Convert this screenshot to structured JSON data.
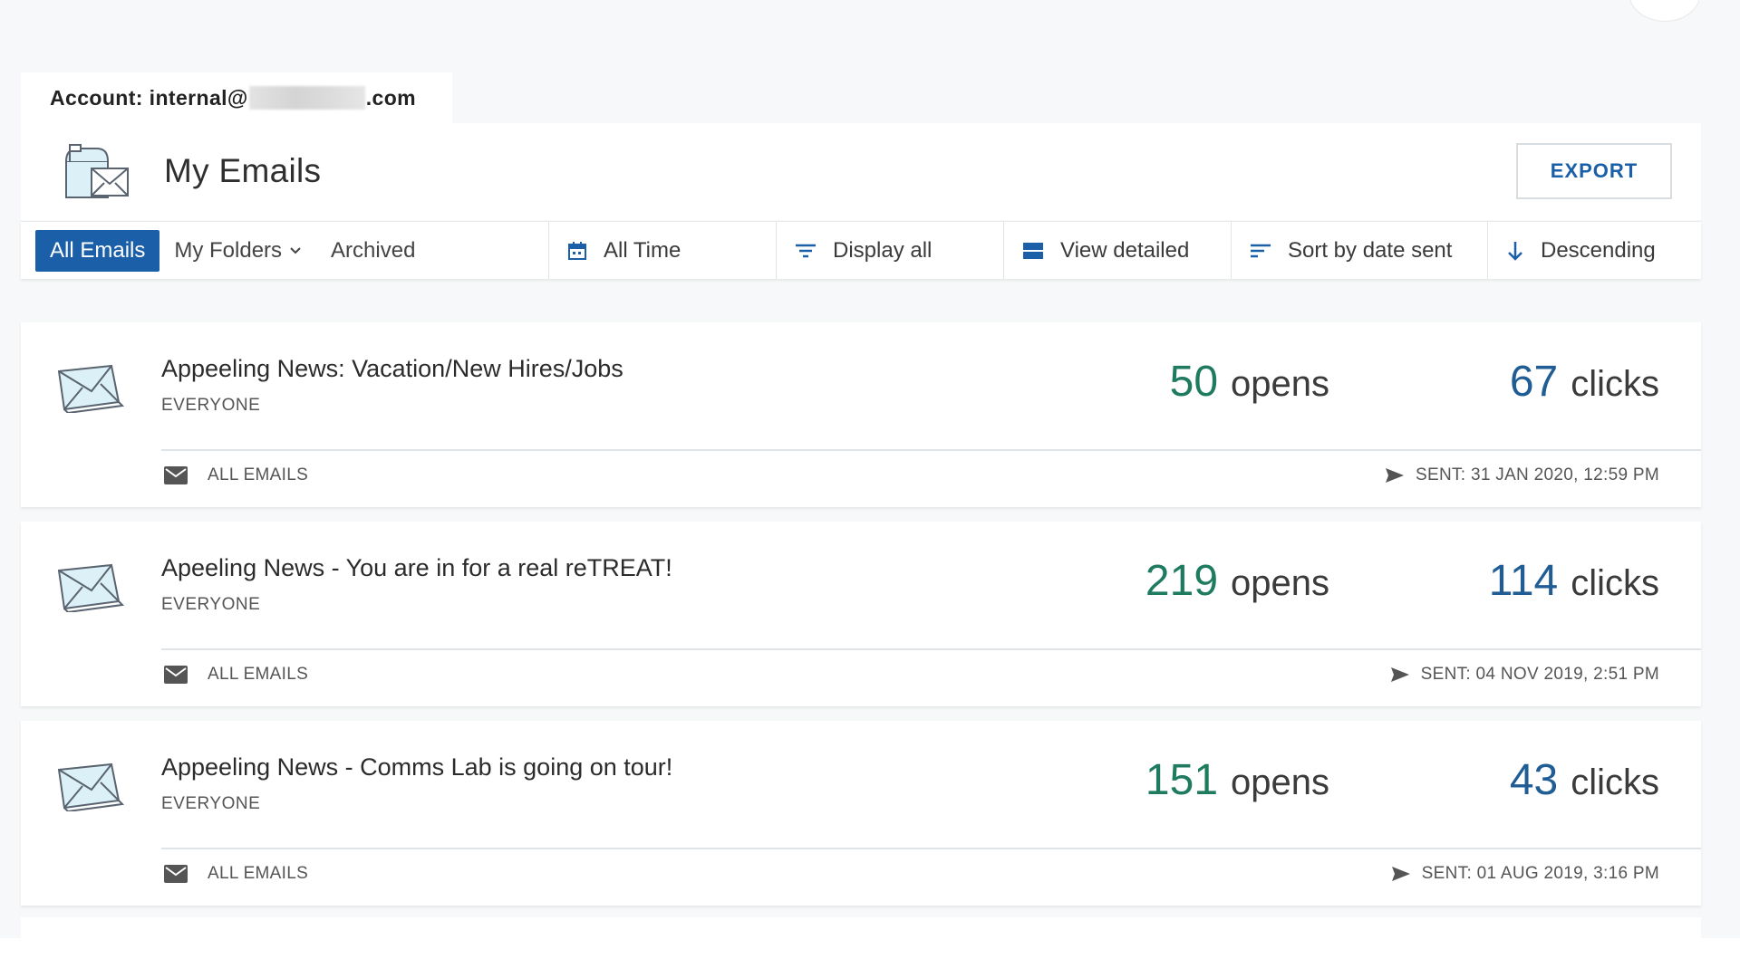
{
  "account": {
    "label": "Account: internal@",
    "domain_suffix": ".com"
  },
  "header": {
    "title": "My Emails",
    "export_label": "EXPORT",
    "icon": "mailbox-icon"
  },
  "toolbar": {
    "tabs": [
      {
        "label": "All Emails",
        "active": true
      },
      {
        "label": "My Folders",
        "active": false,
        "icon": "chevron-down-icon"
      },
      {
        "label": "Archived",
        "active": false
      }
    ],
    "time_filter": {
      "label": "All Time",
      "icon": "calendar-icon"
    },
    "display_filter": {
      "label": "Display all",
      "icon": "filter-icon"
    },
    "view_mode": {
      "label": "View detailed",
      "icon": "view-detailed-icon"
    },
    "sort_by": {
      "label": "Sort by date sent",
      "icon": "sort-icon"
    },
    "sort_order": {
      "label": "Descending",
      "icon": "arrow-down-icon"
    }
  },
  "emails": [
    {
      "title": "Appeeling News: Vacation/New Hires/Jobs",
      "audience": "EVERYONE",
      "opens": "50",
      "opens_label": "opens",
      "clicks": "67",
      "clicks_label": "clicks",
      "folder": "ALL EMAILS",
      "sent": "SENT: 31 JAN 2020, 12:59 PM"
    },
    {
      "title": "Apeeling News - You are in for a real reTREAT!",
      "audience": "EVERYONE",
      "opens": "219",
      "opens_label": "opens",
      "clicks": "114",
      "clicks_label": "clicks",
      "folder": "ALL EMAILS",
      "sent": "SENT: 04 NOV 2019, 2:51 PM"
    },
    {
      "title": "Appeeling News - Comms Lab is going on tour!",
      "audience": "EVERYONE",
      "opens": "151",
      "opens_label": "opens",
      "clicks": "43",
      "clicks_label": "clicks",
      "folder": "ALL EMAILS",
      "sent": "SENT: 01 AUG 2019, 3:16 PM"
    }
  ],
  "colors": {
    "accent": "#1a5fa8",
    "opens": "#1e7b5f",
    "clicks": "#1f5d94"
  }
}
